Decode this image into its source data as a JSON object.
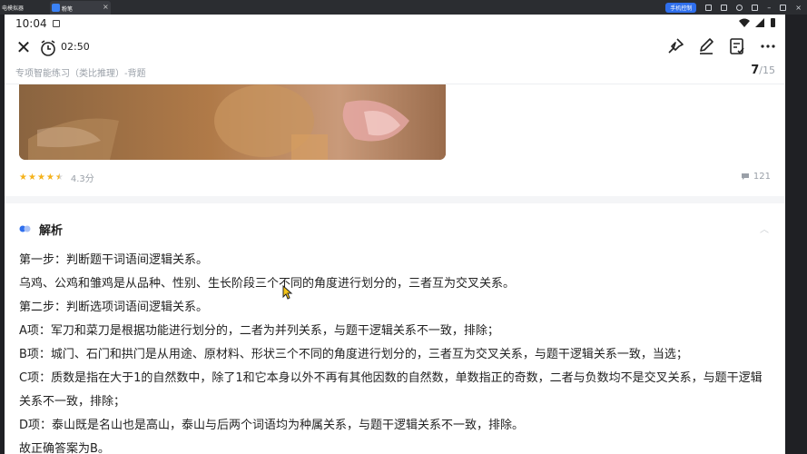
{
  "emulator": {
    "title": "电模拟器",
    "tab_label": "粉笔",
    "pill": "手机控制"
  },
  "status_bar": {
    "time": "10:04"
  },
  "app_bar": {
    "timer": "02:50"
  },
  "subheader": {
    "breadcrumb": "专项智能练习（类比推理）-背题",
    "current": "7",
    "total": "/15"
  },
  "rating": {
    "stars": 4.5,
    "score": "4.3分",
    "comments": "121"
  },
  "analysis": {
    "title": "解析",
    "paragraphs": [
      "第一步：判断题干词语间逻辑关系。",
      "乌鸡、公鸡和雏鸡是从品种、性别、生长阶段三个不同的角度进行划分的，三者互为交叉关系。",
      "第二步：判断选项词语间逻辑关系。",
      "A项：军刀和菜刀是根据功能进行划分的，二者为并列关系，与题干逻辑关系不一致，排除；",
      "B项：城门、石门和拱门是从用途、原材料、形状三个不同的角度进行划分的，三者互为交叉关系，与题干逻辑关系一致，当选；",
      "C项：质数是指在大于1的自然数中，除了1和它本身以外不再有其他因数的自然数，单数指正的奇数，二者与负数均不是交叉关系，与题干逻辑关系不一致，排除；",
      "D项：泰山既是名山也是高山，泰山与后两个词语均为种属关系，与题干逻辑关系不一致，排除。",
      "故正确答案为B。"
    ]
  },
  "colors": {
    "accent": "#2f6fed",
    "star": "#f5b21b",
    "muted": "#9aa0a8"
  }
}
